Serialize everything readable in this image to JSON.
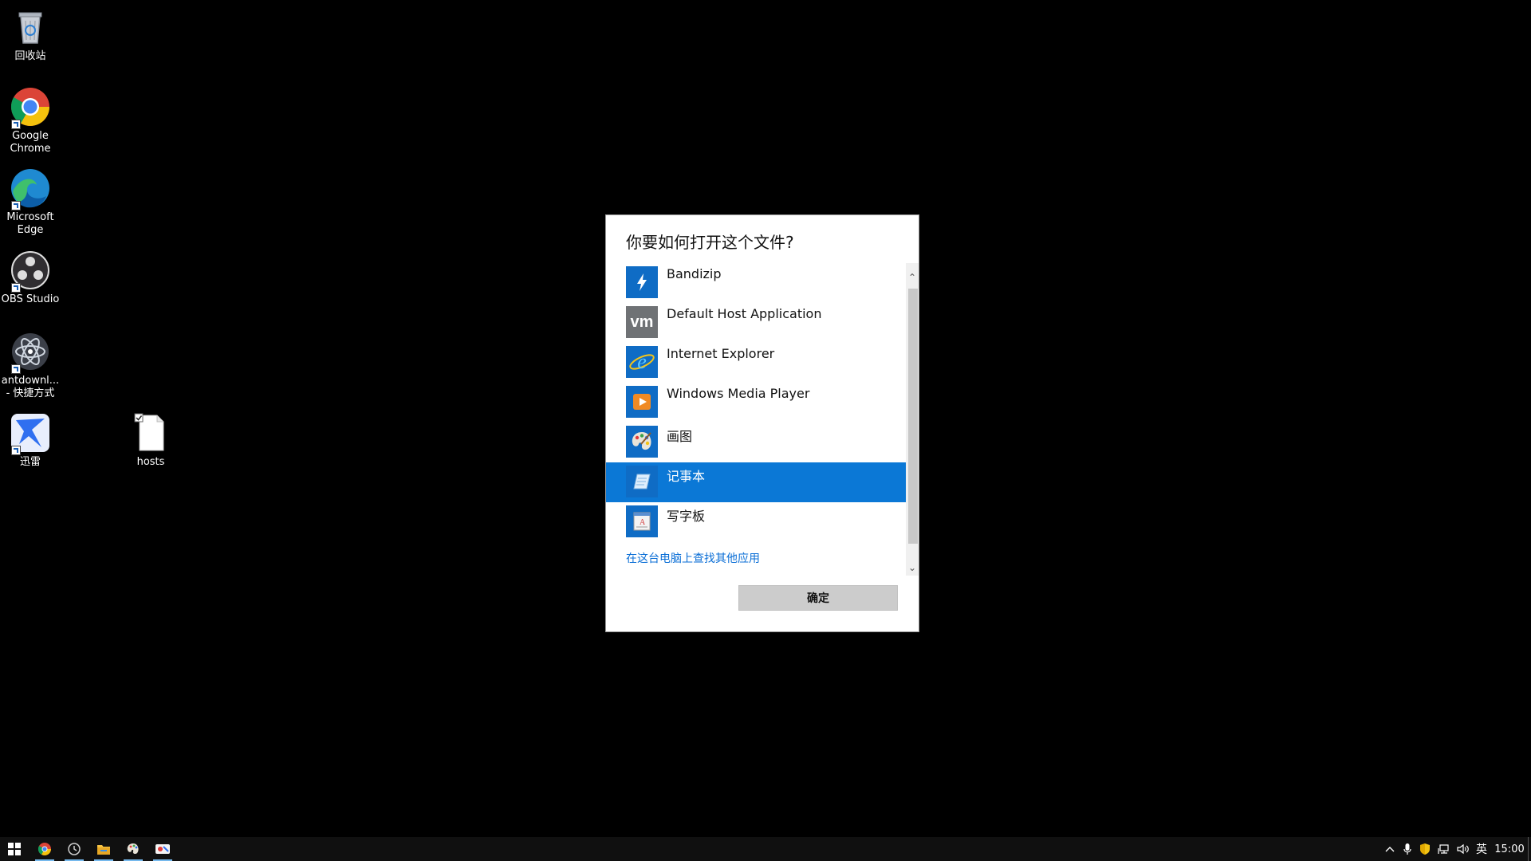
{
  "desktop": {
    "icons": [
      {
        "label": "回收站",
        "icon": "recycle-bin-icon"
      },
      {
        "label": "Google\nChrome",
        "icon": "chrome-icon"
      },
      {
        "label": "Microsoft\nEdge",
        "icon": "edge-icon"
      },
      {
        "label": "OBS Studio",
        "icon": "obs-icon"
      },
      {
        "label": "antdownl...\n- 快捷方式",
        "icon": "antdownload-icon"
      },
      {
        "label": "迅雷",
        "icon": "thunder-icon"
      },
      {
        "label": "hosts",
        "icon": "file-icon"
      }
    ]
  },
  "dialog": {
    "title": "你要如何打开这个文件?",
    "apps": [
      {
        "name": "Bandizip",
        "icon": "bandizip-icon"
      },
      {
        "name": "Default Host Application",
        "icon": "vmware-icon"
      },
      {
        "name": "Internet Explorer",
        "icon": "ie-icon"
      },
      {
        "name": "Windows Media Player",
        "icon": "media-player-icon"
      },
      {
        "name": "画图",
        "icon": "paint-icon"
      },
      {
        "name": "记事本",
        "icon": "notepad-icon",
        "selected": true
      },
      {
        "name": "写字板",
        "icon": "wordpad-icon"
      }
    ],
    "more_link": "在这台电脑上查找其他应用",
    "ok_label": "确定"
  },
  "taskbar": {
    "items": [
      "start-icon",
      "chrome-icon",
      "clock-app-icon",
      "file-explorer-icon",
      "paint-icon",
      "snip-icon"
    ],
    "tray": {
      "ime": "英",
      "time": "15:00"
    }
  },
  "colors": {
    "selection": "#0b78d6",
    "link": "#0a6ed6",
    "desktop_bg": "#000000",
    "taskbar_bg": "#101010"
  }
}
